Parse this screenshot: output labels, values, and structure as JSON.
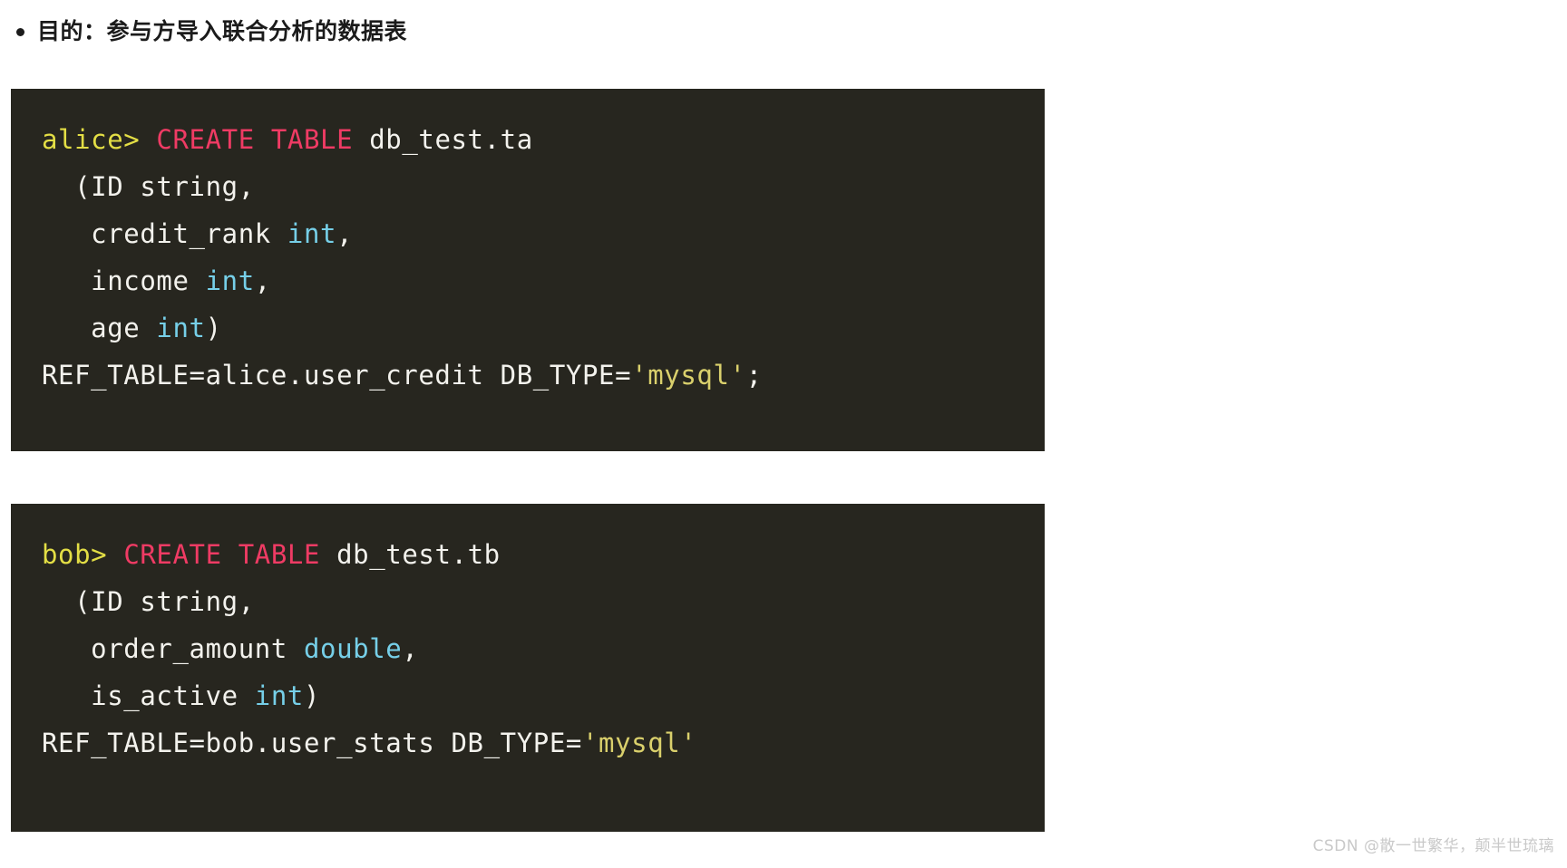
{
  "heading": {
    "bullet_icon": "bullet-dot-icon",
    "text": "目的：参与方导入联合分析的数据表"
  },
  "code_blocks": [
    {
      "id": "alice",
      "name": "alice-create-table-block",
      "plain_text": "alice> CREATE TABLE db_test.ta\n  (ID string,\n   credit_rank int,\n   income int,\n   age int)\nREF_TABLE=alice.user_credit DB_TYPE='mysql';",
      "lines": [
        {
          "tokens": [
            {
              "t": "alice>",
              "c": "prompt"
            },
            {
              "t": " ",
              "c": "plain"
            },
            {
              "t": "CREATE TABLE",
              "c": "kw"
            },
            {
              "t": " db_test.ta",
              "c": "plain"
            }
          ]
        },
        {
          "tokens": [
            {
              "t": "  (ID string,",
              "c": "plain"
            }
          ]
        },
        {
          "tokens": [
            {
              "t": "   credit_rank ",
              "c": "plain"
            },
            {
              "t": "int",
              "c": "type"
            },
            {
              "t": ",",
              "c": "plain"
            }
          ]
        },
        {
          "tokens": [
            {
              "t": "   income ",
              "c": "plain"
            },
            {
              "t": "int",
              "c": "type"
            },
            {
              "t": ",",
              "c": "plain"
            }
          ]
        },
        {
          "tokens": [
            {
              "t": "   age ",
              "c": "plain"
            },
            {
              "t": "int",
              "c": "type"
            },
            {
              "t": ")",
              "c": "plain"
            }
          ]
        },
        {
          "tokens": [
            {
              "t": "REF_TABLE=alice.user_credit DB_TYPE=",
              "c": "plain"
            },
            {
              "t": "'mysql'",
              "c": "str"
            },
            {
              "t": ";",
              "c": "plain"
            }
          ]
        }
      ]
    },
    {
      "id": "bob",
      "name": "bob-create-table-block",
      "plain_text": "bob> CREATE TABLE db_test.tb\n  (ID string,\n   order_amount double,\n   is_active int)\nREF_TABLE=bob.user_stats DB_TYPE='mysql'",
      "lines": [
        {
          "tokens": [
            {
              "t": "bob>",
              "c": "prompt"
            },
            {
              "t": " ",
              "c": "plain"
            },
            {
              "t": "CREATE TABLE",
              "c": "kw"
            },
            {
              "t": " db_test.tb",
              "c": "plain"
            }
          ]
        },
        {
          "tokens": [
            {
              "t": "  (ID string,",
              "c": "plain"
            }
          ]
        },
        {
          "tokens": [
            {
              "t": "   order_amount ",
              "c": "plain"
            },
            {
              "t": "double",
              "c": "type"
            },
            {
              "t": ",",
              "c": "plain"
            }
          ]
        },
        {
          "tokens": [
            {
              "t": "   is_active ",
              "c": "plain"
            },
            {
              "t": "int",
              "c": "type"
            },
            {
              "t": ")",
              "c": "plain"
            }
          ]
        },
        {
          "tokens": [
            {
              "t": "REF_TABLE=bob.user_stats DB_TYPE=",
              "c": "plain"
            },
            {
              "t": "'mysql'",
              "c": "str"
            }
          ]
        }
      ]
    }
  ],
  "watermark": {
    "text": "CSDN @散一世繁华，颠半世琉璃"
  },
  "colors": {
    "page_background": "#ffffff",
    "code_background": "#27261f",
    "text_default": "#f2f1ec",
    "prompt": "#e3de45",
    "keyword": "#ef3b64",
    "type": "#76cfe8",
    "string": "#dad06c",
    "heading": "#1b1b1b",
    "watermark": "#c9c9c9"
  }
}
